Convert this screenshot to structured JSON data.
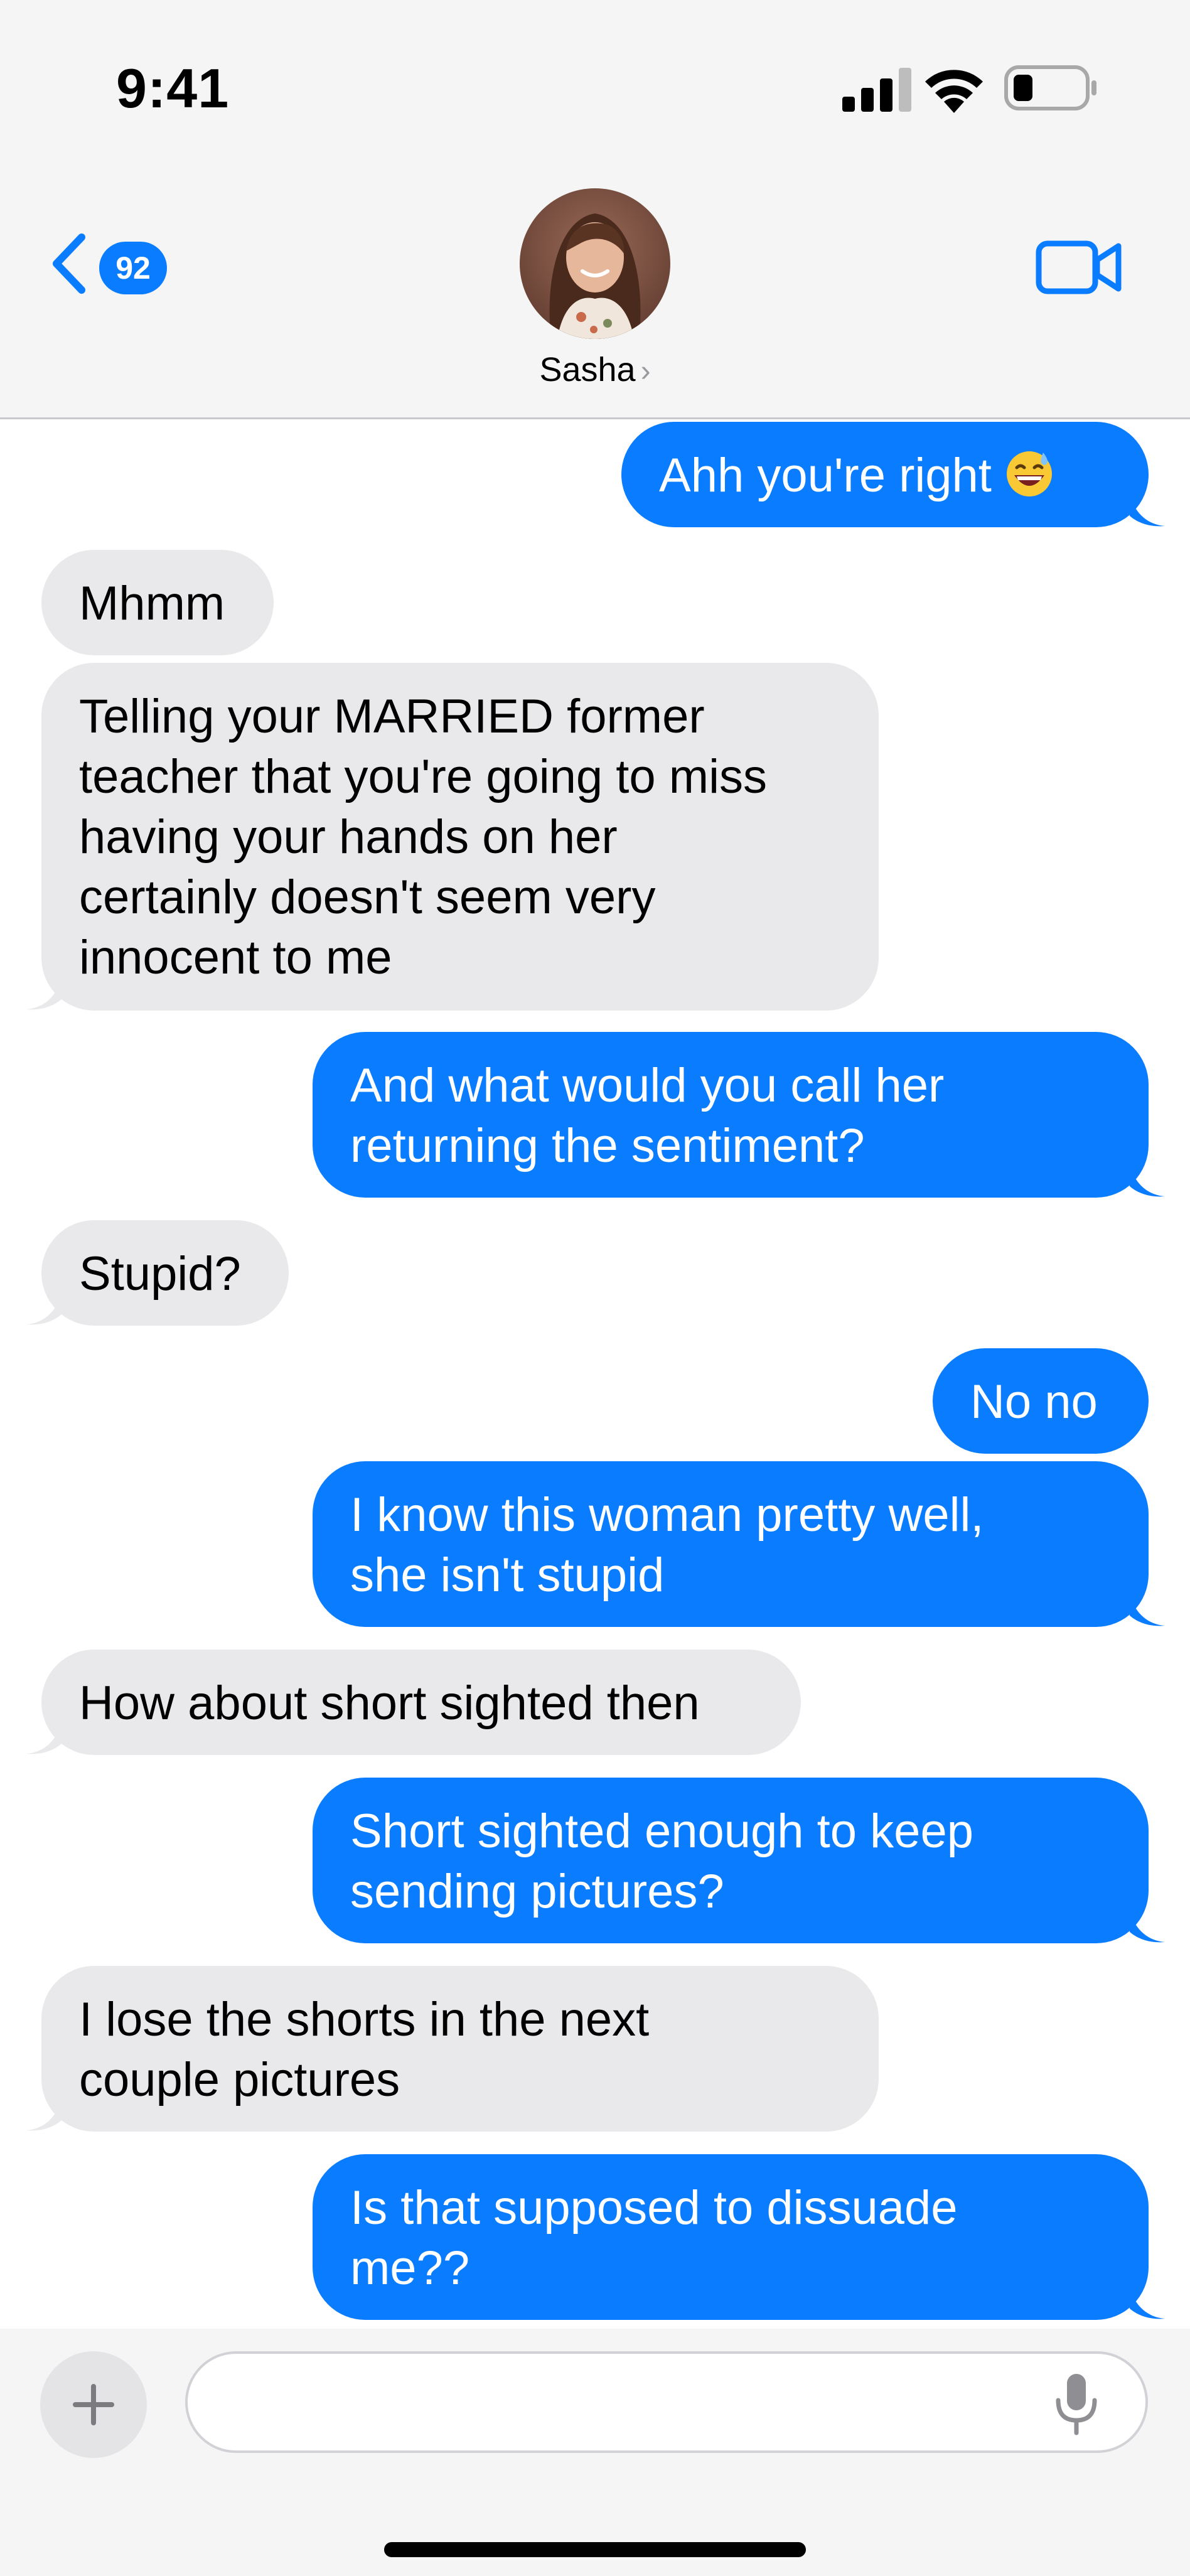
{
  "status_bar": {
    "time": "9:41"
  },
  "header": {
    "back_badge_count": "92",
    "contact_name": "Sasha",
    "contact_chevron": "›",
    "icons": {
      "back": "chevron-left-icon",
      "video": "video-camera-icon"
    }
  },
  "messages": [
    {
      "direction": "sent",
      "lines": [
        "Ahh you're right"
      ],
      "emoji": "grinning-sweat-emoji"
    },
    {
      "direction": "received",
      "lines": [
        "Mhmm"
      ]
    },
    {
      "direction": "received",
      "lines": [
        "Telling your MARRIED former",
        "teacher that you're going to miss",
        "having your hands on her",
        "certainly doesn't seem very",
        "innocent to me"
      ]
    },
    {
      "direction": "sent",
      "lines": [
        "And what would you call her",
        "returning the sentiment?"
      ]
    },
    {
      "direction": "received",
      "lines": [
        "Stupid?"
      ]
    },
    {
      "direction": "sent",
      "lines": [
        "No no"
      ]
    },
    {
      "direction": "sent",
      "lines": [
        "I know this woman pretty well,",
        "she isn't stupid"
      ]
    },
    {
      "direction": "received",
      "lines": [
        "How about short sighted then"
      ]
    },
    {
      "direction": "sent",
      "lines": [
        "Short sighted enough to keep",
        "sending pictures?"
      ]
    },
    {
      "direction": "received",
      "lines": [
        "I lose the shorts in the next",
        "couple pictures"
      ]
    },
    {
      "direction": "sent",
      "lines": [
        "Is that supposed to dissuade",
        "me??"
      ]
    }
  ],
  "input_bar": {
    "placeholder": "",
    "value": ""
  },
  "colors": {
    "sent_bubble": "#0a7cff",
    "received_bubble": "#e9e9eb",
    "accent": "#0a7cff"
  }
}
